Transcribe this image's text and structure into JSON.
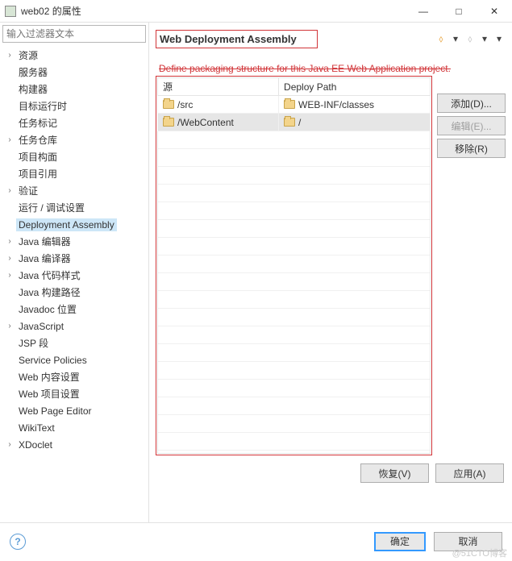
{
  "window": {
    "title": "web02 的属性"
  },
  "filter": {
    "placeholder": "输入过滤器文本"
  },
  "tree": {
    "items": [
      {
        "label": "资源",
        "expandable": true,
        "indent": 0
      },
      {
        "label": "服务器",
        "expandable": false,
        "indent": 0
      },
      {
        "label": "构建器",
        "expandable": false,
        "indent": 0
      },
      {
        "label": "目标运行时",
        "expandable": false,
        "indent": 0
      },
      {
        "label": "任务标记",
        "expandable": false,
        "indent": 0
      },
      {
        "label": "任务仓库",
        "expandable": true,
        "indent": 0
      },
      {
        "label": "项目构面",
        "expandable": false,
        "indent": 0
      },
      {
        "label": "项目引用",
        "expandable": false,
        "indent": 0
      },
      {
        "label": "验证",
        "expandable": true,
        "indent": 0
      },
      {
        "label": "运行 / 调试设置",
        "expandable": false,
        "indent": 0
      },
      {
        "label": "Deployment Assembly",
        "expandable": false,
        "indent": 0,
        "selected": true
      },
      {
        "label": "Java 编辑器",
        "expandable": true,
        "indent": 0
      },
      {
        "label": "Java 编译器",
        "expandable": true,
        "indent": 0
      },
      {
        "label": "Java 代码样式",
        "expandable": true,
        "indent": 0
      },
      {
        "label": "Java 构建路径",
        "expandable": false,
        "indent": 0
      },
      {
        "label": "Javadoc 位置",
        "expandable": false,
        "indent": 0
      },
      {
        "label": "JavaScript",
        "expandable": true,
        "indent": 0
      },
      {
        "label": "JSP 段",
        "expandable": false,
        "indent": 0
      },
      {
        "label": "Service Policies",
        "expandable": false,
        "indent": 0
      },
      {
        "label": "Web 内容设置",
        "expandable": false,
        "indent": 0
      },
      {
        "label": "Web 项目设置",
        "expandable": false,
        "indent": 0
      },
      {
        "label": "Web Page Editor",
        "expandable": false,
        "indent": 0
      },
      {
        "label": "WikiText",
        "expandable": false,
        "indent": 0
      },
      {
        "label": "XDoclet",
        "expandable": true,
        "indent": 0
      }
    ]
  },
  "page": {
    "title": "Web Deployment Assembly",
    "description": "Define packaging structure for this Java EE Web Application project.",
    "columns": {
      "source": "源",
      "deploy": "Deploy Path"
    },
    "rows": [
      {
        "source": "/src",
        "deploy": "WEB-INF/classes",
        "selected": false
      },
      {
        "source": "/WebContent",
        "deploy": "/",
        "selected": true
      }
    ],
    "buttons": {
      "add": "添加(D)...",
      "edit": "编辑(E)...",
      "remove": "移除(R)",
      "restore": "恢复(V)",
      "apply": "应用(A)"
    }
  },
  "footer": {
    "ok": "确定",
    "cancel": "取消"
  },
  "watermark": "@51CTO博客"
}
